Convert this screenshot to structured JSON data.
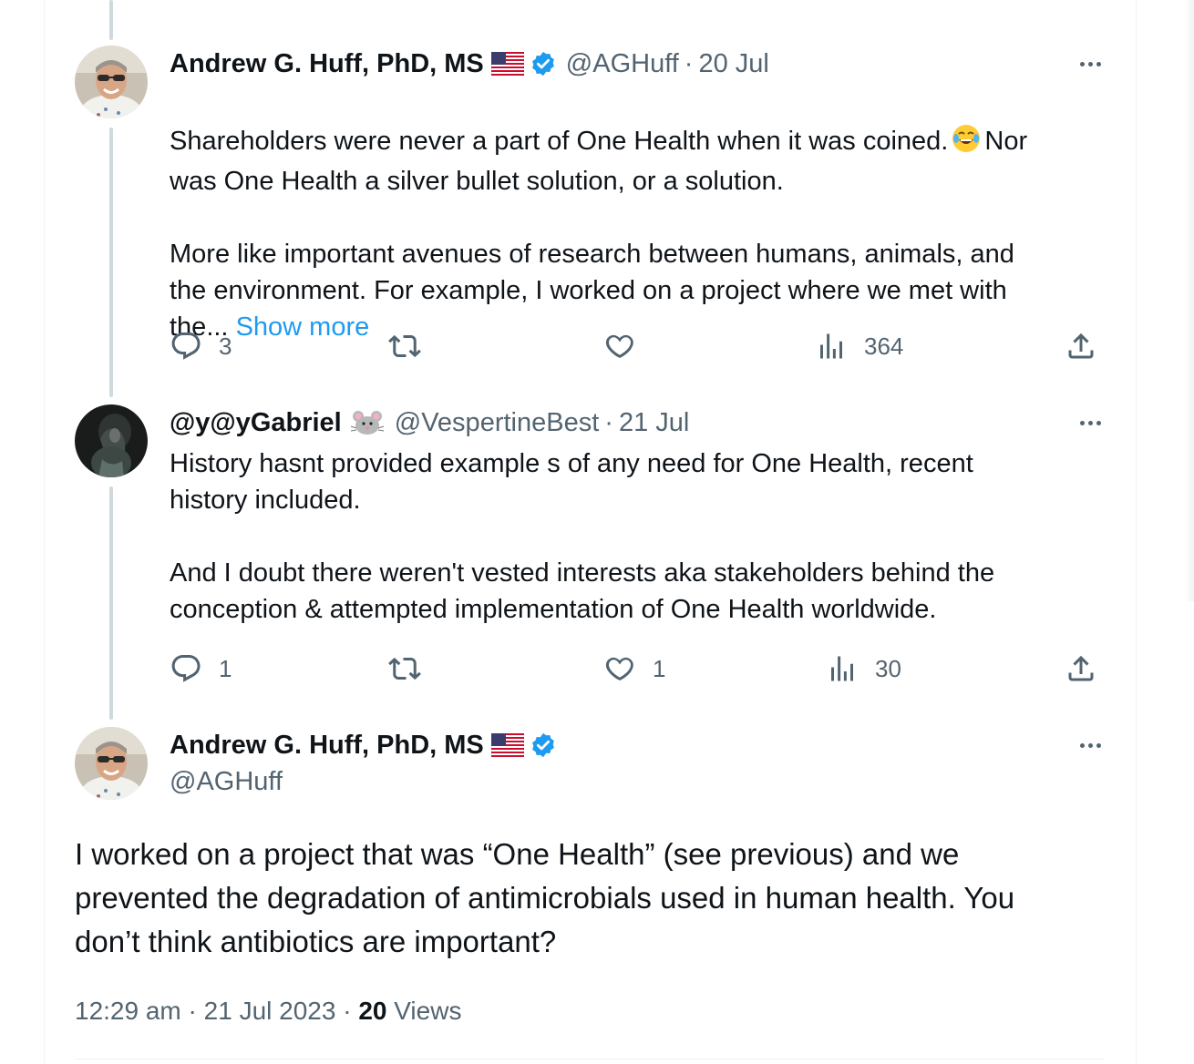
{
  "tweets": [
    {
      "name": "Andrew G. Huff, PhD, MS",
      "handle": "@AGHuff",
      "date": "20 Jul",
      "text_part1": "Shareholders were never a part of One Health when it was coined.",
      "text_part2": "Nor\nwas One Health a silver bullet solution, or a solution.\n\nMore like important avenues of research between humans, animals, and\nthe environment. For example, I worked on a project where we met with\nthe...",
      "show_more": "Show more",
      "replies": "3",
      "retweets": "",
      "likes": "",
      "views": "364",
      "icons": [
        "flag-us-icon",
        "verified-badge-icon",
        "laughing-emoji-icon",
        "more-icon",
        "reply-icon",
        "retweet-icon",
        "like-icon",
        "views-icon",
        "share-icon"
      ]
    },
    {
      "name": "@y@yGabriel",
      "handle": "@VespertineBest",
      "date": "21 Jul",
      "text": "History hasnt provided example s of any need for One Health, recent\nhistory included.\n\nAnd I doubt there weren't vested interests aka stakeholders behind the\nconception & attempted implementation of One Health worldwide.",
      "replies": "1",
      "retweets": "",
      "likes": "1",
      "views": "30",
      "icons": [
        "mouse-emoji-icon",
        "more-icon",
        "reply-icon",
        "retweet-icon",
        "like-icon",
        "views-icon",
        "share-icon"
      ]
    }
  ],
  "main_tweet": {
    "name": "Andrew G. Huff, PhD, MS",
    "handle": "@AGHuff",
    "text": "I worked on a project that was “One Health” (see previous) and we\nprevented the degradation of antimicrobials used in human health. You\ndon’t think antibiotics are important?",
    "time": "12:29 am",
    "date": "21 Jul 2023",
    "views_count": "20",
    "views_label": "Views",
    "separator": "·"
  },
  "colors": {
    "text": "#0f1419",
    "secondary": "#536471",
    "link": "#1d9bf0",
    "thread_line": "#cfd9de",
    "verified": "#1d9bf0"
  }
}
